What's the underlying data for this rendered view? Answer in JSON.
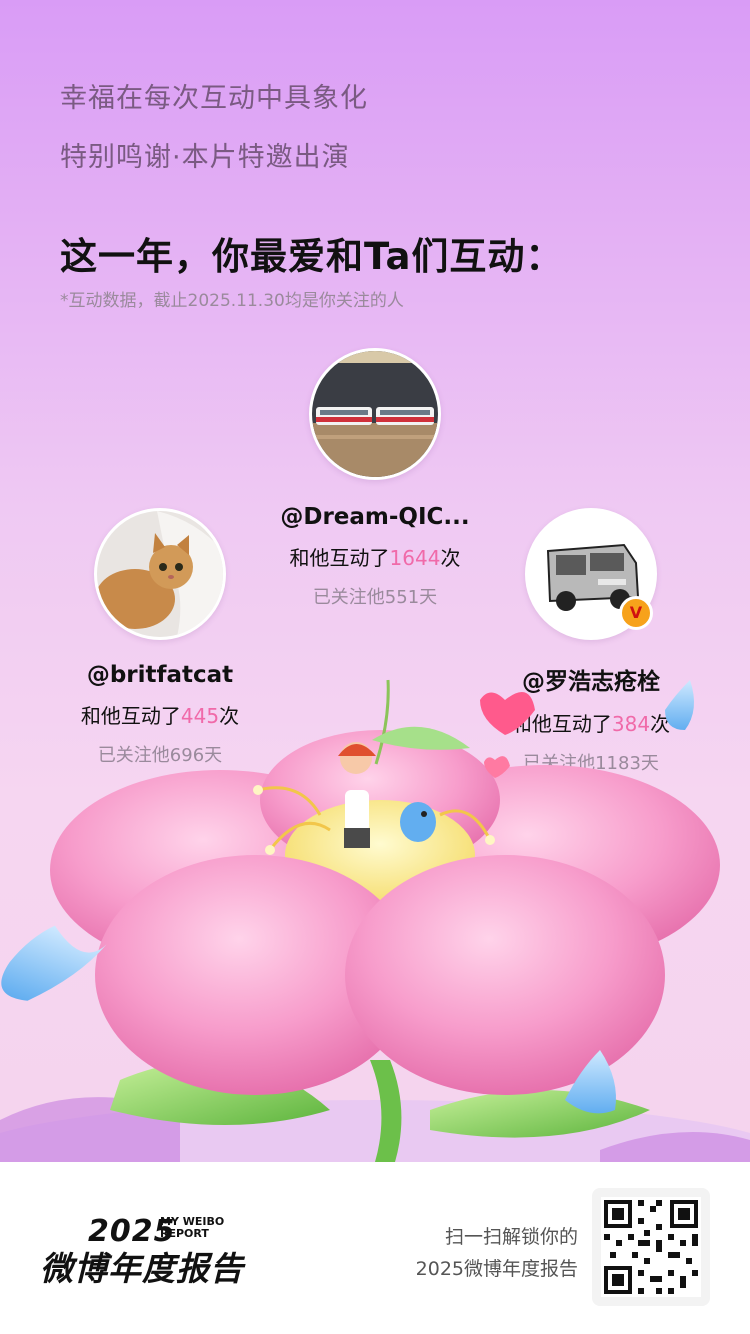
{
  "intro": {
    "line1": "幸福在每次互动中具象化",
    "line2": "特别鸣谢·本片特邀出演"
  },
  "headline": "这一年，你最爱和Ta们互动：",
  "note": "*互动数据，截止2025.11.30均是你关注的人",
  "friends": [
    {
      "handle": "@Dream-QIC...",
      "count_prefix": "和他互动了",
      "count": "1644",
      "count_suffix": "次",
      "days": "已关注他551天",
      "avatar": "bus-photo",
      "verified": false
    },
    {
      "handle": "@britfatcat",
      "count_prefix": "和他互动了",
      "count": "445",
      "count_suffix": "次",
      "days": "已关注他696天",
      "avatar": "cat-photo",
      "verified": false
    },
    {
      "handle": "@罗浩志疮栓",
      "count_prefix": "和他互动了",
      "count": "384",
      "count_suffix": "次",
      "days": "已关注他1183天",
      "avatar": "van-drawing",
      "verified": true,
      "badge": "V"
    }
  ],
  "footer": {
    "brand_year": "2025",
    "brand_en_line1": "MY WEIBO",
    "brand_en_line2": "REPORT",
    "brand_name": "微博年度报告",
    "cta_line1": "扫一扫解锁你的",
    "cta_line2": "2025微博年度报告",
    "qr_icon": "qr-code-icon"
  },
  "colors": {
    "accent_pink": "#f06aa9",
    "bg_top": "#d99cf6",
    "bg_bottom": "#f4d3ec"
  }
}
